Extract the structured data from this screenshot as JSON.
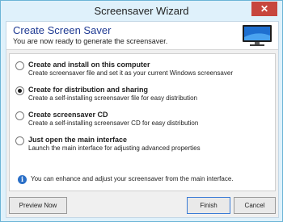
{
  "window": {
    "title": "Screensaver Wizard",
    "close_glyph": "✕"
  },
  "header": {
    "title": "Create Screen Saver",
    "subtitle": "You are now ready to generate the screensaver."
  },
  "options": [
    {
      "title": "Create and install on this computer",
      "description": "Create screensaver file and set it as your current Windows screensaver",
      "selected": false
    },
    {
      "title": "Create for distribution and sharing",
      "description": "Create a self-installing screensaver file for easy distribution",
      "selected": true
    },
    {
      "title": "Create screensaver CD",
      "description": "Create a self-installing screensaver CD for easy distribution",
      "selected": false
    },
    {
      "title": "Just open the main interface",
      "description": "Launch the main interface for adjusting advanced properties",
      "selected": false
    }
  ],
  "info": {
    "icon": "info-icon",
    "text": "You can enhance and adjust your screensaver from the main interface."
  },
  "buttons": {
    "preview": "Preview Now",
    "finish": "Finish",
    "cancel": "Cancel"
  }
}
